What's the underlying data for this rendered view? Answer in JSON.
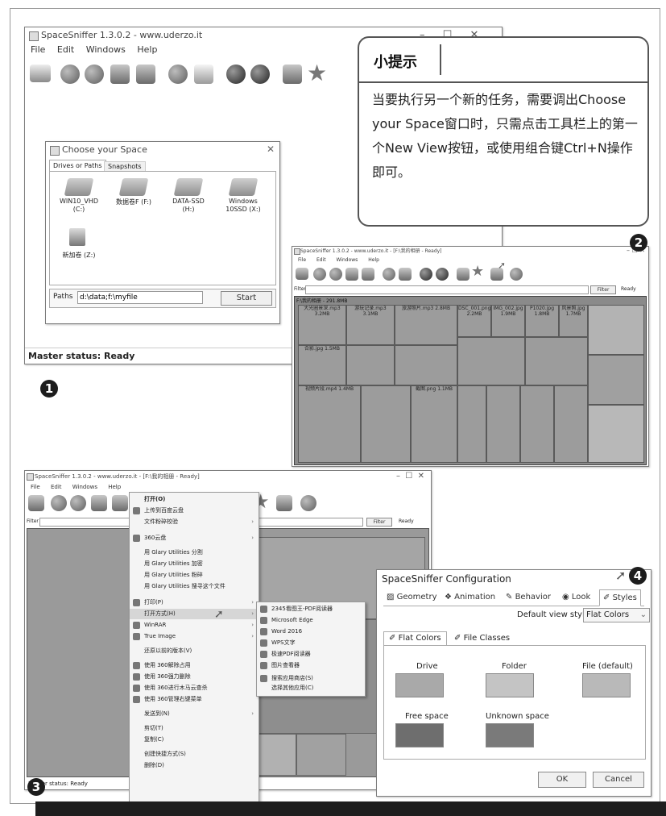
{
  "tip": {
    "title": "小提示",
    "body": "当要执行另一个新的任务，需要调出Choose your Space窗口时，只需点击工具栏上的第一个New View按钮，或使用组合键Ctrl+N操作即可。"
  },
  "badges": [
    "1",
    "2",
    "3",
    "4"
  ],
  "win1": {
    "title": "SpaceSniffer 1.3.0.2 - www.uderzo.it",
    "menus": [
      "File",
      "Edit",
      "Windows",
      "Help"
    ],
    "status": "Master status: Ready"
  },
  "choose_dialog": {
    "title": "Choose your Space",
    "tabs": [
      "Drives or Paths",
      "Snapshots"
    ],
    "drives": [
      {
        "label": "WIN10_VHD",
        "sub": "(C:)"
      },
      {
        "label": "数据卷F (F:)",
        "sub": ""
      },
      {
        "label": "DATA-SSD",
        "sub": "(H:)"
      },
      {
        "label": "Windows",
        "sub": "10SSD (X:)"
      },
      {
        "label": "新加卷 (Z:)",
        "sub": ""
      }
    ],
    "paths_label": "Paths",
    "paths_value": "d:\\data;f:\\myfile",
    "start_label": "Start"
  },
  "win2": {
    "title": "SpaceSniffer 1.3.0.2 - www.uderzo.it - [F:\\我的相册 - Ready]",
    "menus": [
      "File",
      "Edit",
      "Windows",
      "Help"
    ],
    "filter_label": "Filter",
    "filter_button": "Filter",
    "ready": "Ready"
  },
  "win3": {
    "title": "SpaceSniffer 1.3.0.2 - www.uderzo.it - [F:\\我的相册 - Ready]",
    "menus": [
      "File",
      "Edit",
      "Windows",
      "Help"
    ],
    "filter_label": "Filter",
    "filter_button": "Filter",
    "ready": "Ready",
    "status": "Master status: Ready"
  },
  "context_menu": {
    "items": [
      "打开(O)",
      "上传到百度云盘",
      "文件粉碎校验",
      "360云盘",
      "用 Glary Utilities 分割",
      "用 Glary Utilities 加密",
      "用 Glary Utilities 粉碎",
      "用 Glary Utilities 搜寻这个文件",
      "打印(P)",
      "打开方式(H)",
      "WinRAR",
      "True Image",
      "还原以前的版本(V)",
      "使用 360解除占用",
      "使用 360强力删除",
      "使用 360进行木马云查杀",
      "使用 360管理右键菜单",
      "发送到(N)",
      "剪切(T)",
      "复制(C)",
      "创建快捷方式(S)",
      "删除(D)"
    ]
  },
  "submenu": {
    "items": [
      "2345看图王-PDF阅读器",
      "Microsoft Edge",
      "Word 2016",
      "WPS文字",
      "极速PDF阅读器",
      "图片查看器",
      "搜索应用商店(S)",
      "选择其他应用(C)"
    ]
  },
  "config": {
    "title": "SpaceSniffer Configuration",
    "tabs": [
      "Geometry",
      "Animation",
      "Behavior",
      "Look",
      "Styles"
    ],
    "default_view_label": "Default view style",
    "default_view_value": "Flat Colors",
    "subtabs": [
      "Flat Colors",
      "File Classes"
    ],
    "swatches": [
      {
        "label": "Drive",
        "color": "#a9a9a9"
      },
      {
        "label": "Folder",
        "color": "#c4c4c4"
      },
      {
        "label": "File (default)",
        "color": "#b9b9b9"
      },
      {
        "label": "Free space",
        "color": "#6e6e6e"
      },
      {
        "label": "Unknown space",
        "color": "#7a7a7a"
      }
    ],
    "ok": "OK",
    "cancel": "Cancel"
  },
  "treemap": {
    "header": "F:\\我的相册 - 291.8MB",
    "cells": [
      "大光圈景深.mp3 3.2MB",
      "游玩记录.mp3 3.1MB",
      "旅游照片.mp3 2.8MB",
      "DSC_001.png 2.2MB",
      "IMG_002.jpg 1.9MB",
      "P1020.jpg 1.8MB",
      "风景照.jpg 1.7MB",
      "合影.jpg 1.5MB",
      "视频片段.mp4 1.4MB",
      "截图.png 1.1MB"
    ]
  }
}
